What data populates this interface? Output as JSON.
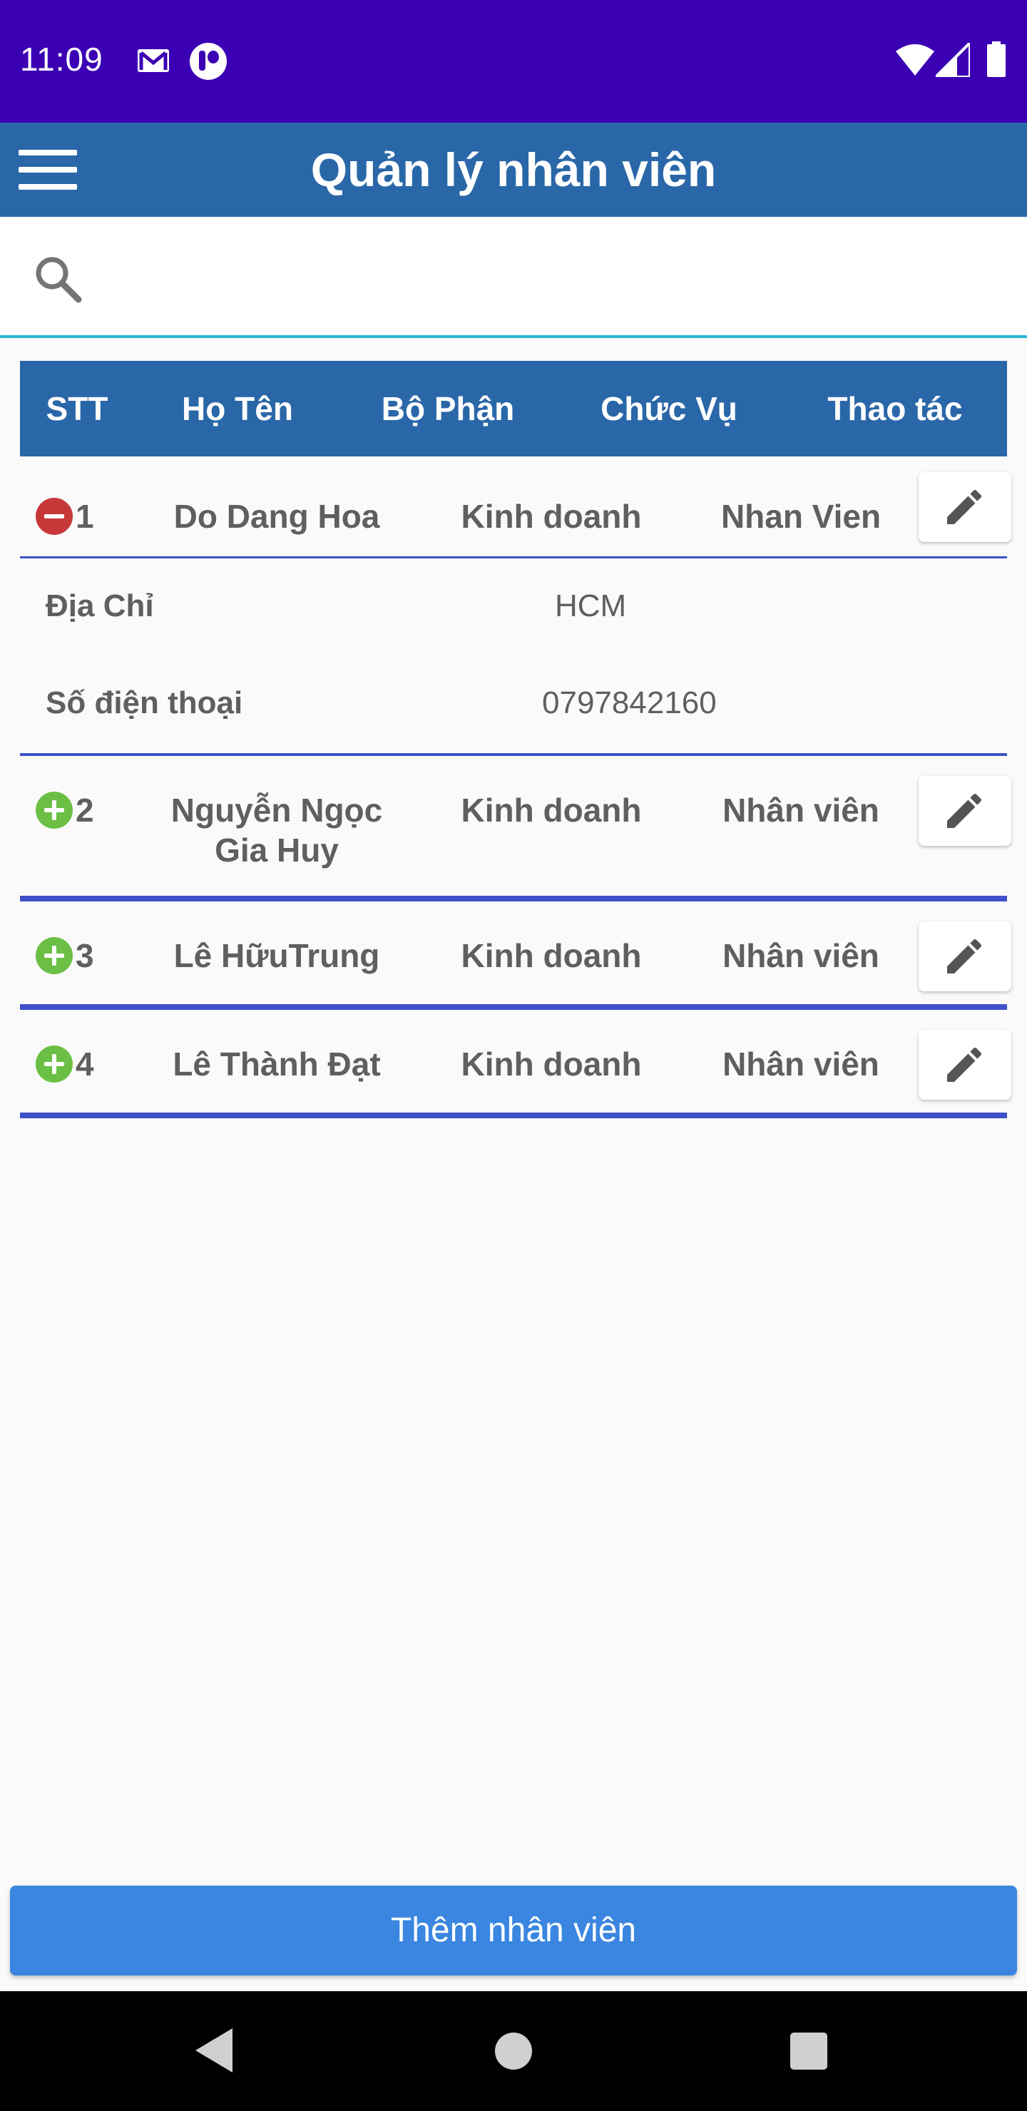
{
  "status_bar": {
    "time": "11:09",
    "icons": [
      "gmail-icon",
      "app-notification-icon",
      "wifi-icon",
      "cell-signal-icon",
      "battery-icon"
    ]
  },
  "app_bar": {
    "title": "Quản lý nhân viên",
    "menu_icon": "hamburger-menu-icon",
    "color": "#2a67a8"
  },
  "search": {
    "icon": "search-icon",
    "value": "",
    "placeholder": ""
  },
  "table": {
    "headers": [
      "STT",
      "Họ Tên",
      "Bộ Phận",
      "Chức Vụ",
      "Thao tác"
    ],
    "rows": [
      {
        "stt": "1",
        "name_lines": [
          "Do Dang Hoa"
        ],
        "department": "Kinh doanh",
        "position": "Nhan Vien",
        "expanded": true,
        "toggle": "collapse-minus-icon"
      },
      {
        "stt": "2",
        "name_lines": [
          "Nguyễn Ngọc",
          "Gia Huy"
        ],
        "department": "Kinh doanh",
        "position": "Nhân viên",
        "expanded": false,
        "toggle": "expand-plus-icon"
      },
      {
        "stt": "3",
        "name_lines": [
          "Lê HữuTrung"
        ],
        "department": "Kinh doanh",
        "position": "Nhân viên",
        "expanded": false,
        "toggle": "expand-plus-icon"
      },
      {
        "stt": "4",
        "name_lines": [
          "Lê Thành Đạt"
        ],
        "department": "Kinh doanh",
        "position": "Nhân viên",
        "expanded": false,
        "toggle": "expand-plus-icon"
      }
    ],
    "details": {
      "address_label": "Địa Chỉ",
      "address_value": "HCM",
      "phone_label": "Số điện thoại",
      "phone_value": "0797842160"
    },
    "edit_icon": "pencil-edit-icon"
  },
  "add_button": {
    "label": "Thêm nhân viên",
    "color": "#3a86e0"
  },
  "colors": {
    "status_bar": "#3c00b4",
    "separator": "#3f51c8",
    "minus": "#c8383a",
    "plus": "#6bbf44"
  }
}
